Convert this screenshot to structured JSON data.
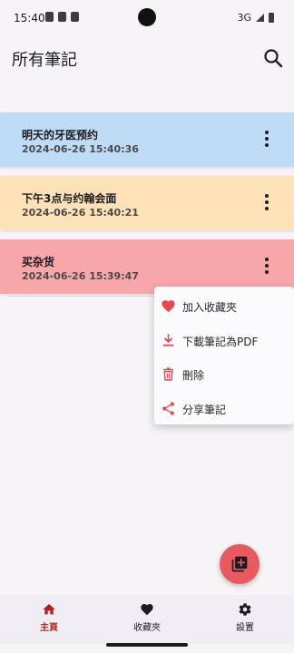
{
  "status_bar": {
    "time": "15:40",
    "network": "3G"
  },
  "header": {
    "title": "所有筆記"
  },
  "notes": [
    {
      "title": "明天的牙医预约",
      "date": "2024-06-26 15:40:36",
      "color": "#bedcf5"
    },
    {
      "title": "下午3点与约翰会面",
      "date": "2024-06-26 15:40:21",
      "color": "#fde2b8"
    },
    {
      "title": "买杂货",
      "date": "2024-06-26 15:39:47",
      "color": "#f7a7a9"
    }
  ],
  "context_menu": {
    "items": [
      {
        "label": "加入收藏夾",
        "icon": "heart-icon"
      },
      {
        "label": "下載筆記為PDF",
        "icon": "download-icon"
      },
      {
        "label": "刪除",
        "icon": "trash-icon"
      },
      {
        "label": "分享筆記",
        "icon": "share-icon"
      }
    ]
  },
  "fab": {
    "icon": "add-note-icon"
  },
  "bottom_nav": {
    "items": [
      {
        "label": "主頁",
        "icon": "home-icon",
        "active": true
      },
      {
        "label": "收藏夾",
        "icon": "heart-icon",
        "active": false
      },
      {
        "label": "設置",
        "icon": "gear-icon",
        "active": false
      }
    ]
  },
  "colors": {
    "accent": "#e85a5f",
    "active_nav": "#b71c1c"
  }
}
